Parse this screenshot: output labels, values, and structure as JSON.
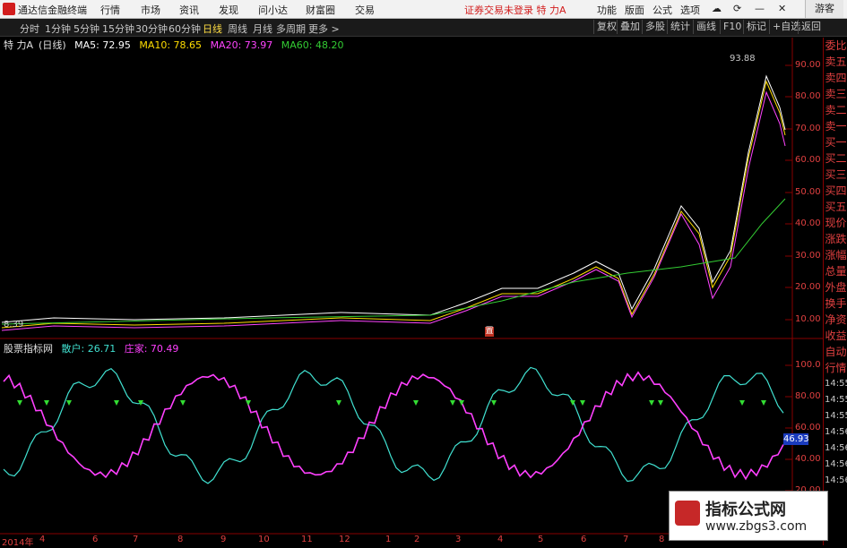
{
  "menubar": {
    "app_name": "通达信金融终端",
    "items": [
      "行情",
      "市场",
      "资讯",
      "发现",
      "问小达",
      "财富圈",
      "交易"
    ],
    "notice": "证券交易未登录  特 力A",
    "right_items": [
      "功能",
      "版面",
      "公式",
      "选项"
    ],
    "guest_label": "游客"
  },
  "periodbar": {
    "periods": [
      "分时",
      "1分钟",
      "5分钟",
      "15分钟",
      "30分钟",
      "60分钟",
      "日线",
      "周线",
      "月线",
      "多周期",
      "更多 >"
    ],
    "active": "日线",
    "tools": [
      "复权",
      "叠加",
      "多股",
      "统计",
      "画线",
      "F10",
      "标记",
      "+自选",
      "返回"
    ]
  },
  "main_legend": {
    "title": "特 力A",
    "period": "(日线)",
    "ma5": "MA5: 72.95",
    "ma10": "MA10: 78.65",
    "ma20": "MA20: 73.97",
    "ma60": "MA60: 48.20"
  },
  "indicator_legend": {
    "title": "股票指标网",
    "retail": "散户: 26.71",
    "dealer": "庄家: 70.49"
  },
  "price_chart": {
    "high_label": "93.88",
    "low_label": "8.39",
    "mid_marker": "置",
    "axis_labels": [
      "90.00",
      "80.00",
      "70.00",
      "60.00",
      "50.00",
      "40.00",
      "30.00",
      "20.00",
      "10.00"
    ]
  },
  "indicator_chart": {
    "axis_labels": [
      "100.0",
      "80.00",
      "60.00",
      "40.00",
      "20.00"
    ],
    "current_value_badge": "46.93"
  },
  "date_axis": {
    "labels": [
      "2014年",
      "4",
      "6",
      "7",
      "8",
      "9",
      "10",
      "11",
      "12",
      "1",
      "2",
      "3",
      "4",
      "5",
      "6",
      "7",
      "8",
      "9",
      "10"
    ]
  },
  "side_panel": {
    "items": [
      "委比",
      "卖五",
      "卖四",
      "卖三",
      "卖二",
      "卖一",
      "买一",
      "买二",
      "买三",
      "买四",
      "买五",
      "现价",
      "涨跌",
      "涨幅",
      "总量",
      "外盘",
      "换手",
      "净资",
      "收益"
    ],
    "items2": [
      "自动",
      "行情"
    ],
    "times": [
      "14:55",
      "14:55",
      "14:55",
      "14:56",
      "14:56",
      "14:56",
      "14:56",
      "14:56"
    ]
  },
  "watermark": {
    "title": "指标公式网",
    "url": "www.zbgs3.com"
  },
  "colors": {
    "ma5": "#ffffff",
    "ma10": "#ffdd00",
    "ma20": "#ff44ff",
    "ma60": "#33cc33",
    "retail_line": "#40e0d0",
    "dealer_line": "#ff40ff",
    "axis_red": "#e04040"
  }
}
